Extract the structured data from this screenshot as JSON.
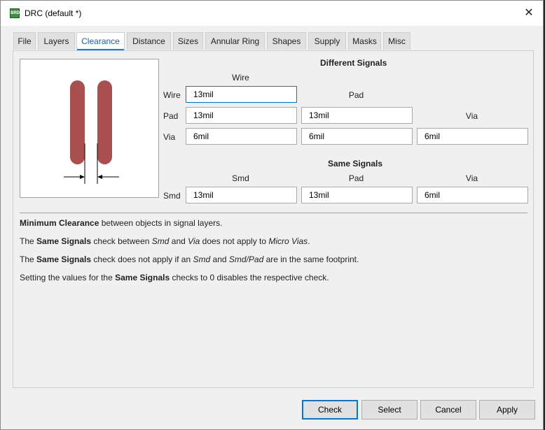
{
  "window": {
    "title": "DRC (default *)",
    "close_glyph": "✕",
    "icon": "board-icon",
    "icon_text": "BRD"
  },
  "tabs": [
    "File",
    "Layers",
    "Clearance",
    "Distance",
    "Sizes",
    "Annular Ring",
    "Shapes",
    "Supply",
    "Masks",
    "Misc"
  ],
  "active_tab": "Clearance",
  "different_signals": {
    "title": "Different Signals",
    "col_wire": "Wire",
    "col_pad": "Pad",
    "col_via": "Via",
    "row_wire": "Wire",
    "row_pad": "Pad",
    "row_via": "Via",
    "wire_wire": "13mil",
    "pad_wire": "13mil",
    "pad_pad": "13mil",
    "via_wire": "6mil",
    "via_pad": "6mil",
    "via_via": "6mil"
  },
  "same_signals": {
    "title": "Same Signals",
    "col_smd": "Smd",
    "col_pad": "Pad",
    "col_via": "Via",
    "row_smd": "Smd",
    "smd_smd": "13mil",
    "smd_pad": "13mil",
    "smd_via": "6mil"
  },
  "info": {
    "line1_bold": "Minimum Clearance",
    "line1_rest": " between objects in signal layers.",
    "line2_a": "The ",
    "line2_b": "Same Signals",
    "line2_c": " check between ",
    "line2_d": "Smd",
    "line2_e": " and ",
    "line2_f": "Via",
    "line2_g": " does not apply to ",
    "line2_h": "Micro Vias",
    "line2_i": ".",
    "line3_a": "The ",
    "line3_b": "Same Signals",
    "line3_c": " check does not apply if an ",
    "line3_d": "Smd",
    "line3_e": " and ",
    "line3_f": "Smd/Pad",
    "line3_g": " are in the same footprint.",
    "line4_a": "Setting the values for the ",
    "line4_b": "Same Signals",
    "line4_c": " checks to 0 disables the respective check."
  },
  "buttons": {
    "check": "Check",
    "select": "Select",
    "cancel": "Cancel",
    "apply": "Apply"
  },
  "colors": {
    "trace": "#a94f4f",
    "accent": "#0078d7",
    "active_tab_text": "#1560b6"
  }
}
